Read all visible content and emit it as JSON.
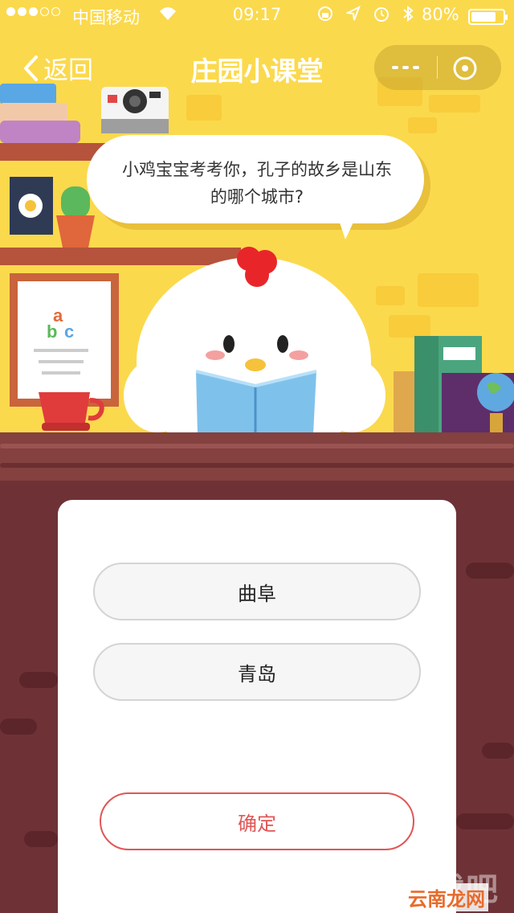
{
  "status_bar": {
    "carrier": "中国移动",
    "time": "09:17",
    "battery": "80%",
    "battery_level": 0.8
  },
  "nav": {
    "back_label": "返回",
    "title": "庄园小课堂"
  },
  "question": {
    "text": "小鸡宝宝考考你，孔子的故乡是山东的哪个城市?"
  },
  "illustration": {
    "letters": [
      "a",
      "b",
      "c"
    ]
  },
  "options": [
    {
      "label": "曲阜"
    },
    {
      "label": "青岛"
    }
  ],
  "confirm_label": "确定",
  "watermark": {
    "main": "下载吧",
    "sub": "云南龙网"
  },
  "colors": {
    "background_yellow": "#fbd94d",
    "wood": "#6e3236",
    "accent_red": "#e15656"
  }
}
